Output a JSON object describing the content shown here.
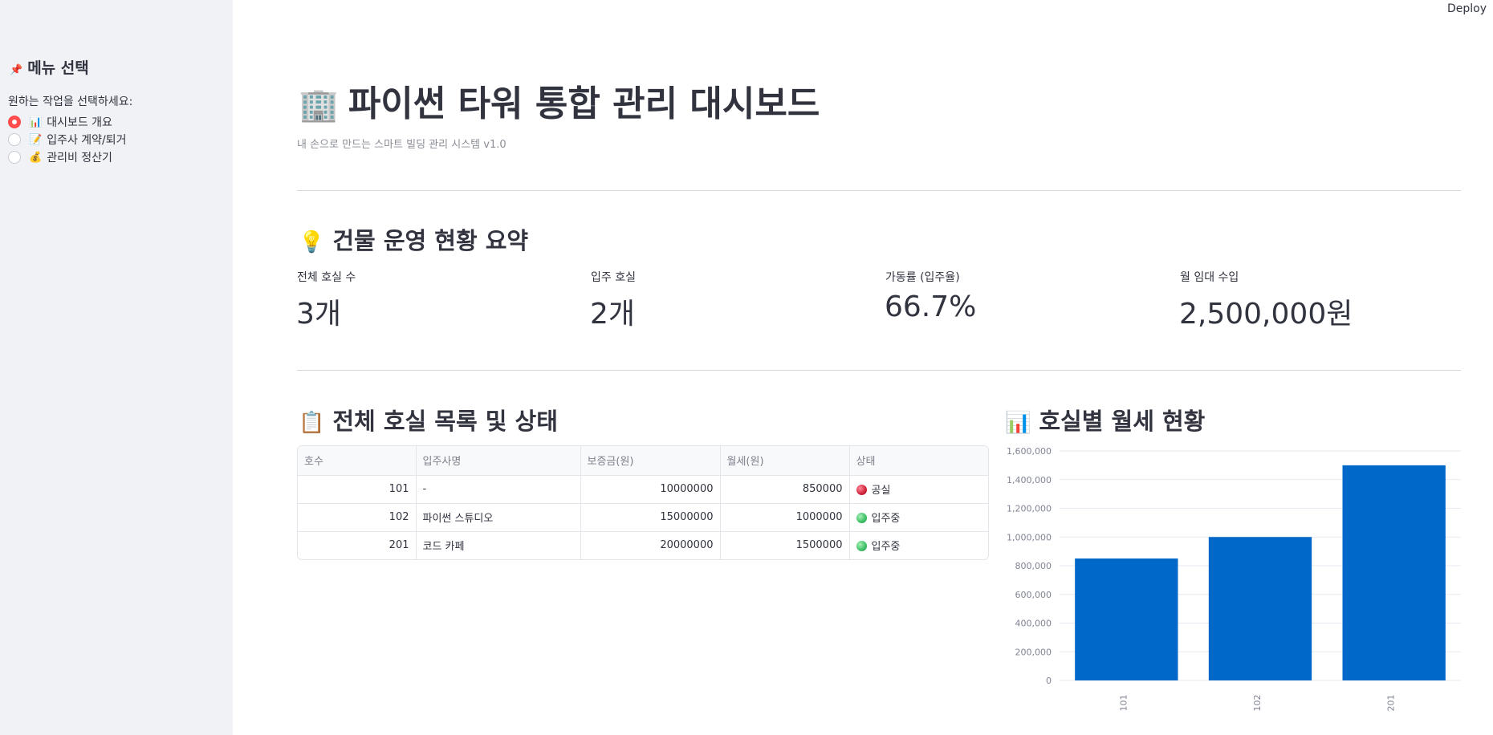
{
  "app": {
    "deploy_label": "Deploy"
  },
  "sidebar": {
    "title_icon": "📌",
    "title": "메뉴 선택",
    "prompt": "원하는 작업을 선택하세요:",
    "options": [
      {
        "icon": "📊",
        "label": "대시보드 개요",
        "selected": true
      },
      {
        "icon": "📝",
        "label": "입주사 계약/퇴거",
        "selected": false
      },
      {
        "icon": "💰",
        "label": "관리비 정산기",
        "selected": false
      }
    ]
  },
  "header": {
    "icon": "🏢",
    "title": "파이썬 타워 통합 관리 대시보드",
    "subtitle": "내 손으로 만드는 스마트 빌딩 관리 시스템 v1.0"
  },
  "summary": {
    "icon": "💡",
    "title": "건물 운영 현황 요약",
    "metrics": [
      {
        "label": "전체 호실 수",
        "value": "3개"
      },
      {
        "label": "입주 호실",
        "value": "2개"
      },
      {
        "label": "가동률 (입주율)",
        "value": "66.7%"
      },
      {
        "label": "월 임대 수입",
        "value": "2,500,000원"
      }
    ]
  },
  "rooms": {
    "icon": "📋",
    "title": "전체 호실 목록 및 상태",
    "columns": [
      "호수",
      "입주사명",
      "보증금(원)",
      "월세(원)",
      "상태"
    ],
    "rows": [
      {
        "room": "101",
        "tenant": "-",
        "deposit": "10000000",
        "rent": "850000",
        "status": "공실",
        "status_color": "#d0223b"
      },
      {
        "room": "102",
        "tenant": "파이썬 스튜디오",
        "deposit": "15000000",
        "rent": "1000000",
        "status": "입주중",
        "status_color": "#3cbf63"
      },
      {
        "room": "201",
        "tenant": "코드 카페",
        "deposit": "20000000",
        "rent": "1500000",
        "status": "입주중",
        "status_color": "#3cbf63"
      }
    ]
  },
  "rent_chart": {
    "icon": "📊",
    "title": "호실별 월세 현황"
  },
  "chart_data": {
    "type": "bar",
    "categories": [
      "101",
      "102",
      "201"
    ],
    "values": [
      850000,
      1000000,
      1500000
    ],
    "ylim": [
      0,
      1600000
    ],
    "yticks": [
      0,
      200000,
      400000,
      600000,
      800000,
      1000000,
      1200000,
      1400000,
      1600000
    ],
    "grid": true,
    "bar_color": "#0068c9"
  }
}
